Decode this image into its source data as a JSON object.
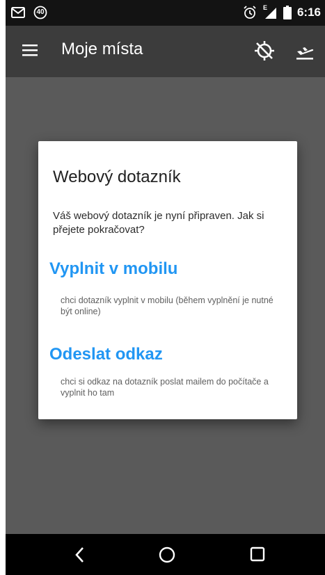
{
  "status_bar": {
    "notification_count": "40",
    "network_label": "E",
    "time": "6:16",
    "icons": [
      "mail-icon",
      "notification-count-icon",
      "alarm-icon",
      "signal-icon",
      "battery-icon"
    ]
  },
  "app_bar": {
    "title": "Moje místa",
    "icons": [
      "menu-icon",
      "gps-off-icon",
      "flight-icon"
    ]
  },
  "dialog": {
    "title": "Webový dotazník",
    "message": "Váš webový dotazník je nyní připraven. Jak si přejete pokračovat?",
    "options": [
      {
        "title": "Vyplnit v mobilu",
        "description": "chci dotazník vyplnit v mobilu (během vyplnění je nutné být online)"
      },
      {
        "title": "Odeslat odkaz",
        "description": "chci si odkaz na dotazník poslat mailem do počítače a vyplnit ho tam"
      }
    ]
  },
  "navigation_bar": {
    "icons": [
      "back-icon",
      "home-icon",
      "recents-icon"
    ]
  },
  "colors": {
    "status_bar": "#131313",
    "app_bar": "#3c3c3c",
    "scrim_background": "#5a5a5a",
    "accent": "#2196f3"
  }
}
